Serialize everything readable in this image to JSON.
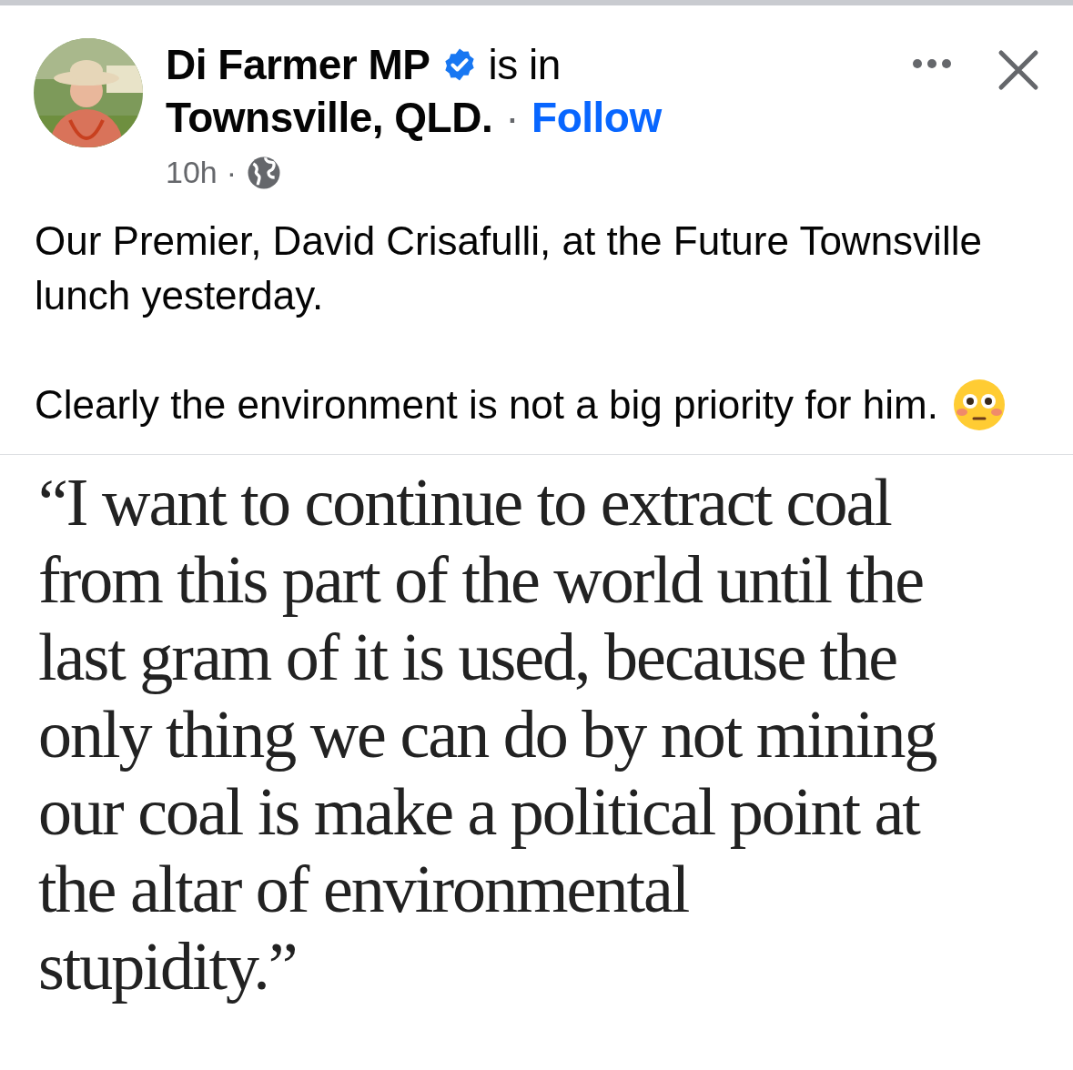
{
  "post": {
    "author": "Di Farmer MP",
    "verified": true,
    "location_prefix": "is in",
    "location": "Townsville, QLD.",
    "separator": "·",
    "follow": "Follow",
    "time": "10h",
    "time_separator": "·",
    "paragraphs": [
      "Our Premier, David Crisafulli, at the Future Townsville lunch yesterday.",
      "Clearly the environment is not a big priority for him."
    ],
    "quote_lines": [
      "“I want to continue to extract coal",
      "from this part of the world until the",
      "last gram of it is used, because the",
      "only thing we can do by not mining",
      "our coal is make a political point at",
      "the altar of environmental",
      "stupidity.”"
    ]
  }
}
